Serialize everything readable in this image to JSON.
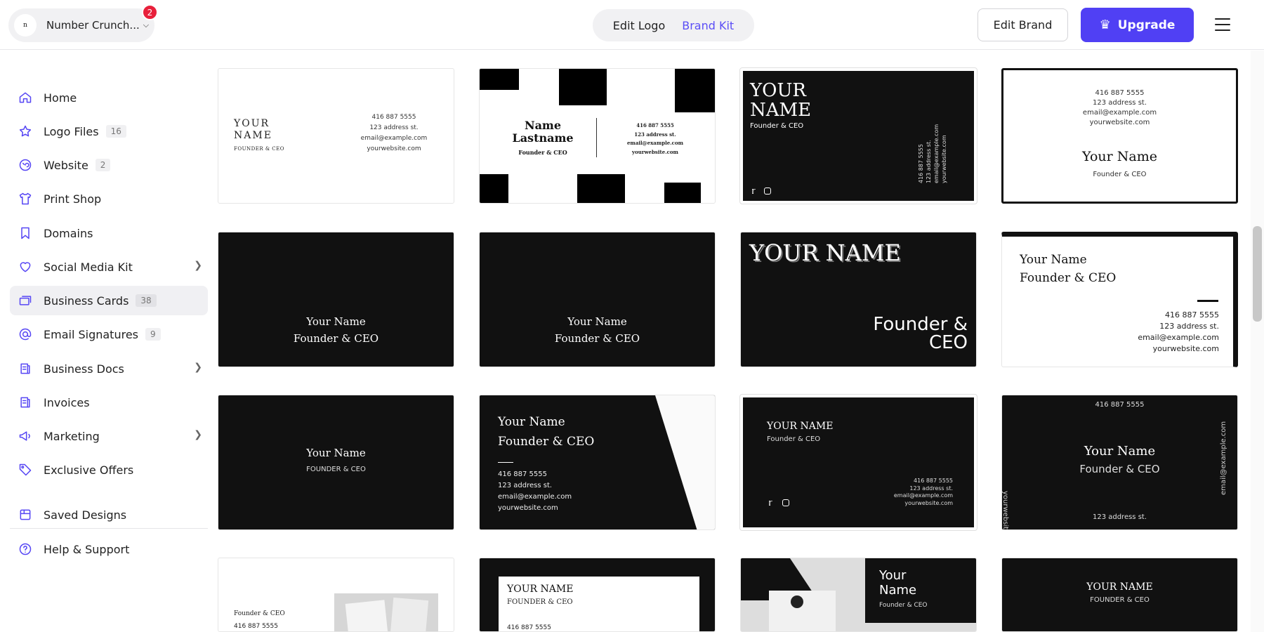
{
  "header": {
    "brand_name": "Number Crunch...",
    "logo_text": "n",
    "notification_count": "2",
    "tabs": {
      "edit_logo": "Edit Logo",
      "brand_kit": "Brand Kit"
    },
    "edit_brand": "Edit Brand",
    "upgrade": "Upgrade"
  },
  "sidebar": {
    "items": [
      {
        "label": "Home"
      },
      {
        "label": "Logo Files",
        "count": "16"
      },
      {
        "label": "Website",
        "count": "2"
      },
      {
        "label": "Print Shop"
      },
      {
        "label": "Domains"
      },
      {
        "label": "Social Media Kit"
      },
      {
        "label": "Business Cards",
        "count": "38"
      },
      {
        "label": "Email Signatures",
        "count": "9"
      },
      {
        "label": "Business Docs"
      },
      {
        "label": "Invoices"
      },
      {
        "label": "Marketing"
      },
      {
        "label": "Exclusive Offers"
      },
      {
        "label": "Saved Designs"
      },
      {
        "label": "Help & Support"
      }
    ]
  },
  "cards": {
    "c1": {
      "name_l1": "YOUR",
      "name_l2": "NAME",
      "title": "FOUNDER & CEO",
      "phone": "416 887 5555",
      "address": "123 address st.",
      "email": "email@example.com",
      "web": "yourwebsite.com"
    },
    "c2": {
      "name_l1": "Name",
      "name_l2": "Lastname",
      "title": "Founder & CEO",
      "phone": "416 887 5555",
      "address": "123 address st.",
      "email": "email@example.com",
      "web": "yourwebsite.com"
    },
    "c3": {
      "name_l1": "YOUR",
      "name_l2": "NAME",
      "title": "Founder & CEO",
      "phone": "416 887 5555",
      "address": "123 address st.",
      "email": "email@example.com",
      "web": "yourwebsite.com"
    },
    "c4": {
      "phone": "416 887 5555",
      "address": "123 address st.",
      "email": "email@example.com",
      "web": "yourwebsite.com",
      "name": "Your Name",
      "title": "Founder & CEO"
    },
    "c5": {
      "name": "Your Name",
      "title": "Founder & CEO"
    },
    "c6": {
      "name": "Your Name",
      "title": "Founder & CEO"
    },
    "c7": {
      "name": "YOUR NAME",
      "title_l1": "Founder &",
      "title_l2": "CEO"
    },
    "c8": {
      "name": "Your Name",
      "title": "Founder & CEO",
      "phone": "416 887 5555",
      "address": "123 address st.",
      "email": "email@example.com",
      "web": "yourwebsite.com"
    },
    "c9": {
      "name": "Your Name",
      "title": "FOUNDER & CEO"
    },
    "c10": {
      "name": "Your Name",
      "title": "Founder & CEO",
      "phone": "416 887 5555",
      "address": "123 address st.",
      "email": "email@example.com",
      "web": "yourwebsite.com"
    },
    "c11": {
      "name": "YOUR NAME",
      "title": "Founder & CEO",
      "phone": "416 887 5555",
      "address": "123 address st.",
      "email": "email@example.com",
      "web": "yourwebsite.com"
    },
    "c12": {
      "phone": "416 887 5555",
      "name": "Your Name",
      "title": "Founder & CEO",
      "address": "123 address st.",
      "web": "yourwebsite.com",
      "email": "email@example.com"
    },
    "c13": {
      "title": "Founder & CEO",
      "phone": "416 887 5555"
    },
    "c14": {
      "name": "YOUR NAME",
      "title": "FOUNDER & CEO",
      "phone": "416 887 5555"
    },
    "c15": {
      "name_l1": "Your",
      "name_l2": "Name",
      "title": "Founder & CEO"
    },
    "c16": {
      "name": "YOUR NAME",
      "title": "FOUNDER & CEO"
    }
  }
}
